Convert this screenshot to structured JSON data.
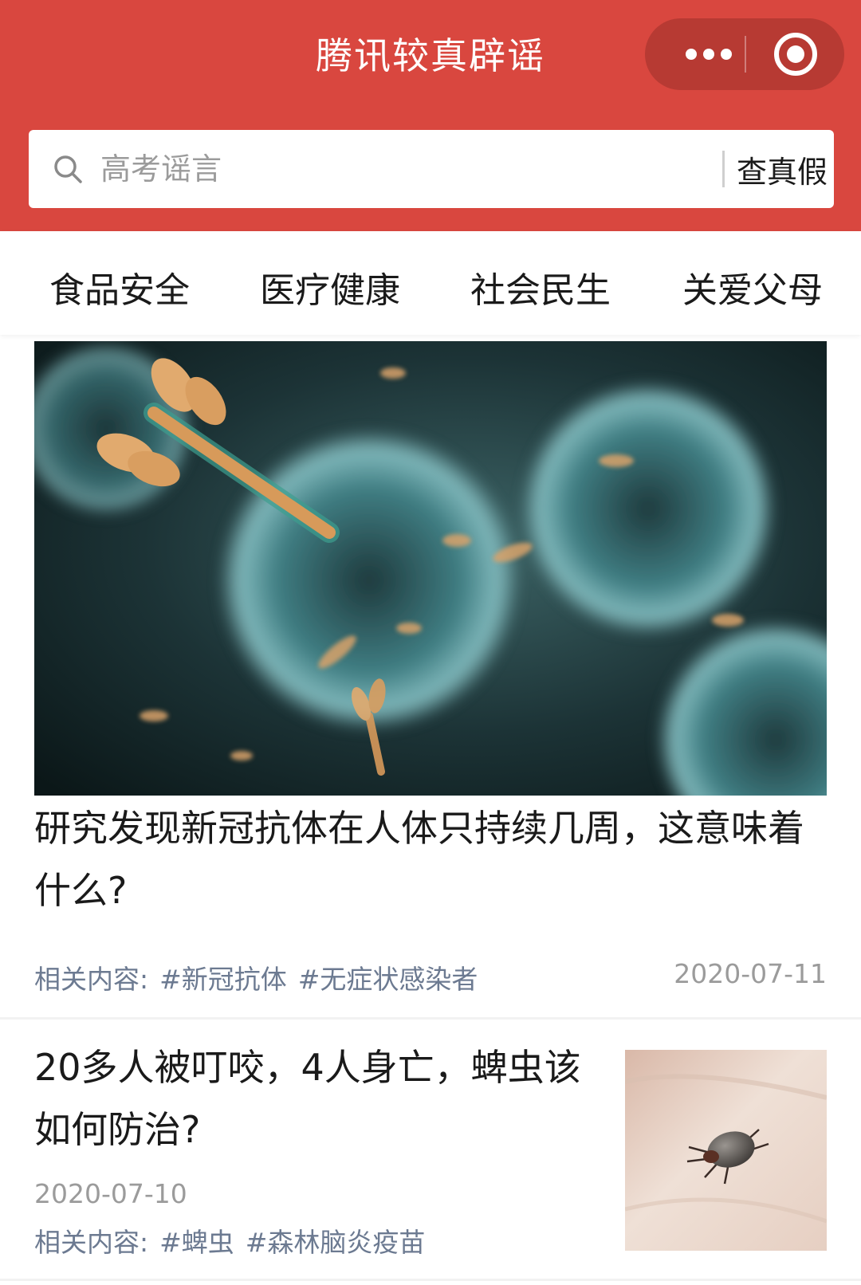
{
  "header": {
    "title": "腾讯较真辟谣",
    "menu_icon": "more-dots-icon",
    "close_icon": "target-circle-icon",
    "bg_color": "#d9473f"
  },
  "search": {
    "placeholder": "高考谣言",
    "button_label": "查真假",
    "icon": "search-icon"
  },
  "tabs": [
    {
      "label": "食品安全"
    },
    {
      "label": "医疗健康"
    },
    {
      "label": "社会民生"
    },
    {
      "label": "关爱父母"
    }
  ],
  "articles": [
    {
      "title": "研究发现新冠抗体在人体只持续几周，这意味着什么?",
      "tags_prefix": "相关内容:",
      "tags": [
        "#新冠抗体",
        "#无症状感染者"
      ],
      "date": "2020-07-11",
      "image": "virus-antibody-image"
    },
    {
      "title": "20多人被叮咬，4人身亡，蜱虫该如何防治?",
      "tags_prefix": "相关内容:",
      "tags": [
        "#蜱虫",
        "#森林脑炎疫苗"
      ],
      "date": "2020-07-10",
      "image": "tick-on-skin-image"
    }
  ],
  "colors": {
    "tag_text": "#6c7a91",
    "date_text": "#9b9b9b"
  }
}
